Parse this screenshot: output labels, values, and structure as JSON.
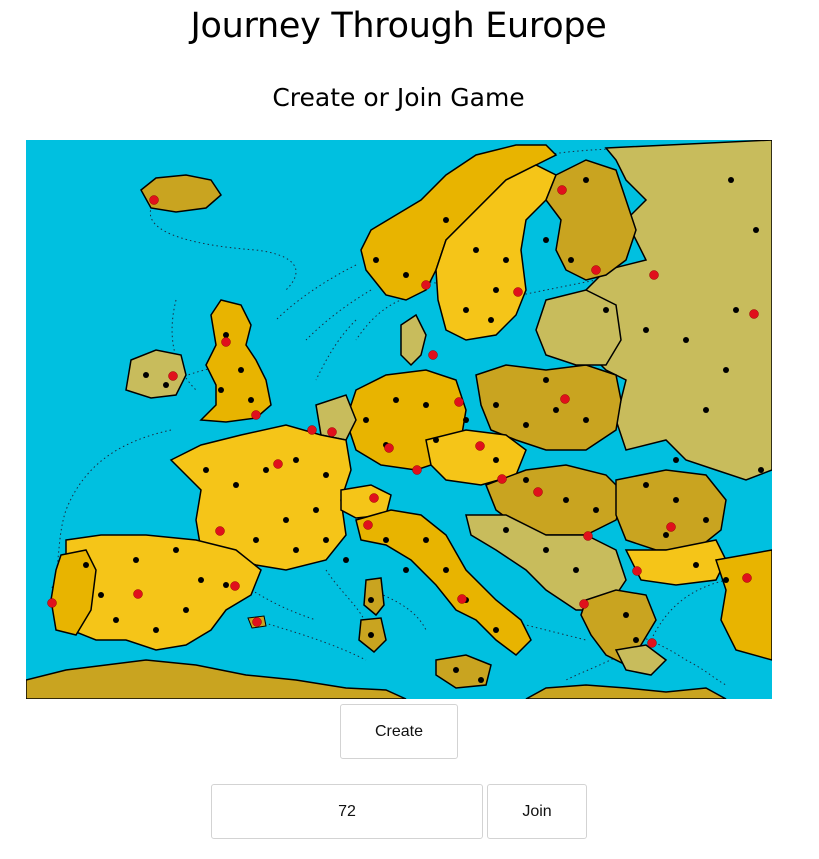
{
  "page": {
    "title": "Journey Through Europe",
    "subtitle": "Create or Join Game"
  },
  "map": {
    "icon": "europe-map",
    "colors": {
      "sea": "#00c0e0",
      "land_olive": "#c8bc5c",
      "land_gold": "#e8b400",
      "land_yellow": "#f5c518",
      "land_dark": "#c9a420",
      "city_red": "#e0101c",
      "city_black": "#000000"
    }
  },
  "actions": {
    "create_label": "Create",
    "join_label": "Join",
    "game_id_value": "72"
  }
}
